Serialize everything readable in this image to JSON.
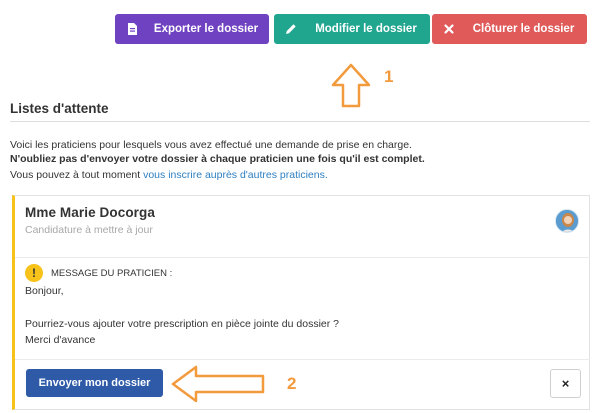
{
  "toolbar": {
    "export_label": "Exporter le dossier",
    "edit_label": "Modifier le dossier",
    "close_label": "Clôturer le dossier"
  },
  "annotations": {
    "step1": "1",
    "step2": "2"
  },
  "section": {
    "title": "Listes d'attente",
    "intro_line1": "Voici les praticiens pour lesquels vous avez effectué une demande de prise en charge.",
    "intro_line2": "N'oubliez pas d'envoyer votre dossier à chaque praticien une fois qu'il est complet.",
    "intro_line3_prefix": "Vous pouvez à tout moment ",
    "intro_line3_link": "vous inscrire auprès d'autres praticiens."
  },
  "card": {
    "practitioner_name": "Mme Marie Docorga",
    "status": "Candidature à mettre à jour",
    "message_header": "MESSAGE DU PRATICIEN :",
    "message_line1": "Bonjour,",
    "message_line2": "Pourriez-vous ajouter votre prescription en pièce jointe du dossier ?",
    "message_line3": "Merci d'avance",
    "send_label": "Envoyer mon dossier",
    "dismiss_label": "×"
  },
  "colors": {
    "export": "#6f42c1",
    "edit": "#20a58f",
    "close": "#e05a5a",
    "send": "#2e5aa8",
    "warning": "#f7c21a",
    "annotation": "#f39a3d",
    "link": "#2d7fc1"
  },
  "icons": {
    "export": "document-icon",
    "edit": "pencil-icon",
    "close": "close-icon",
    "warning": "exclamation-icon"
  }
}
